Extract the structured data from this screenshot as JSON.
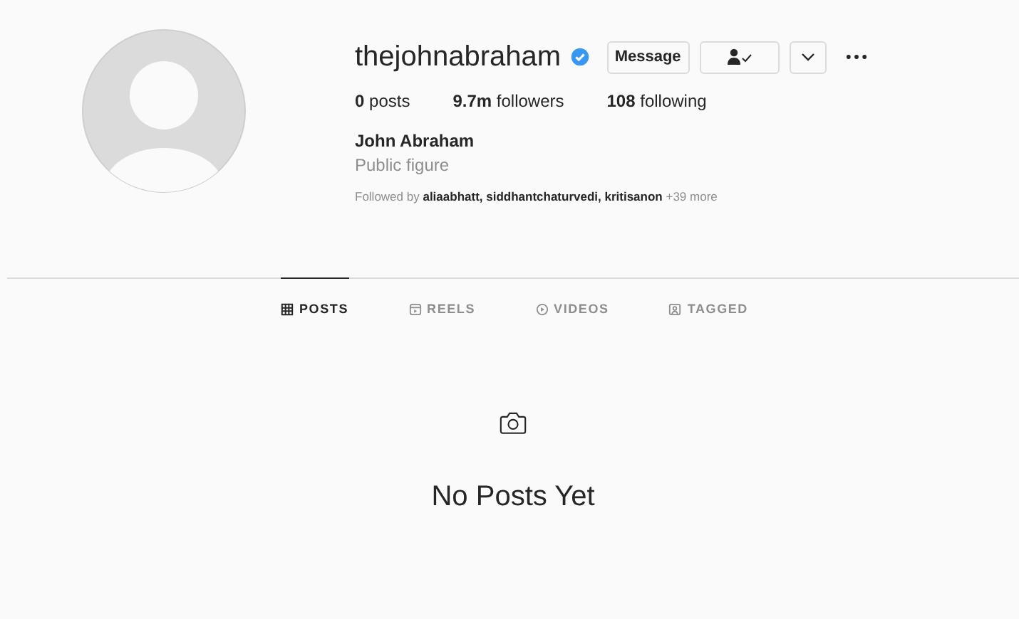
{
  "profile": {
    "username": "thejohnabraham",
    "verified": true,
    "buttons": [
      {
        "kind": "message",
        "label": "Message"
      },
      {
        "kind": "following"
      },
      {
        "kind": "dropdown"
      }
    ],
    "stats": [
      "**0** posts",
      "**9.7m** followers",
      "**108** following"
    ],
    "name": "John Abraham",
    "category": "Public figure",
    "followed_by": "Followed by **aliaabhatt, siddhantchaturvedi, kritisanon** +39 more"
  },
  "tabs": [
    {
      "kind": "grid",
      "label": "POSTS",
      "selected": true
    },
    {
      "kind": "reels",
      "label": "REELS",
      "selected": false
    },
    {
      "kind": "videos",
      "label": "VIDEOS",
      "selected": false
    },
    {
      "kind": "tagged",
      "label": "TAGGED",
      "selected": false
    }
  ],
  "empty_state": {
    "title": "No Posts Yet"
  }
}
